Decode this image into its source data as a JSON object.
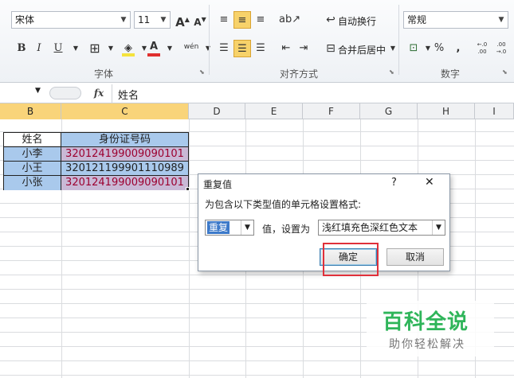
{
  "ribbon": {
    "font_name": "宋体",
    "font_size": "11",
    "grow_font": "A",
    "shrink_font": "A",
    "bold": "B",
    "italic": "I",
    "underline": "U",
    "font_color_letter": "A",
    "phonetic": "wén",
    "wrap_text": "自动换行",
    "merge_center": "合并后居中",
    "number_format": "常规",
    "percent": "%",
    "comma": ",",
    "inc_decimal": "←.0\n.00",
    "dec_decimal": ".00\n→.0",
    "groups": {
      "font": "字体",
      "alignment": "对齐方式",
      "number": "数字"
    }
  },
  "formula_bar": {
    "fx": "fx",
    "value": "姓名"
  },
  "columns": [
    "B",
    "C",
    "D",
    "E",
    "F",
    "G",
    "H",
    "I"
  ],
  "table": {
    "header": [
      "姓名",
      "身份证号码"
    ],
    "rows": [
      {
        "name": "小李",
        "id": "320124199009090101",
        "dup": true
      },
      {
        "name": "小王",
        "id": "320121199901110989",
        "dup": false
      },
      {
        "name": "小张",
        "id": "320124199009090101",
        "dup": true
      }
    ]
  },
  "dialog": {
    "title": "重复值",
    "help": "?",
    "close": "✕",
    "prompt": "为包含以下类型值的单元格设置格式:",
    "type_value": "重复",
    "mid_label": "值，设置为",
    "format_value": "浅红填充色深红色文本",
    "ok": "确定",
    "cancel": "取消"
  },
  "watermark": {
    "title": "百科全说",
    "subtitle": "助你轻松解决"
  },
  "colors": {
    "dup_fill": "#f2c9d1",
    "dup_text": "#9c0030",
    "highlight": "#e0303a",
    "selected_fill": "#a9c9ec"
  }
}
